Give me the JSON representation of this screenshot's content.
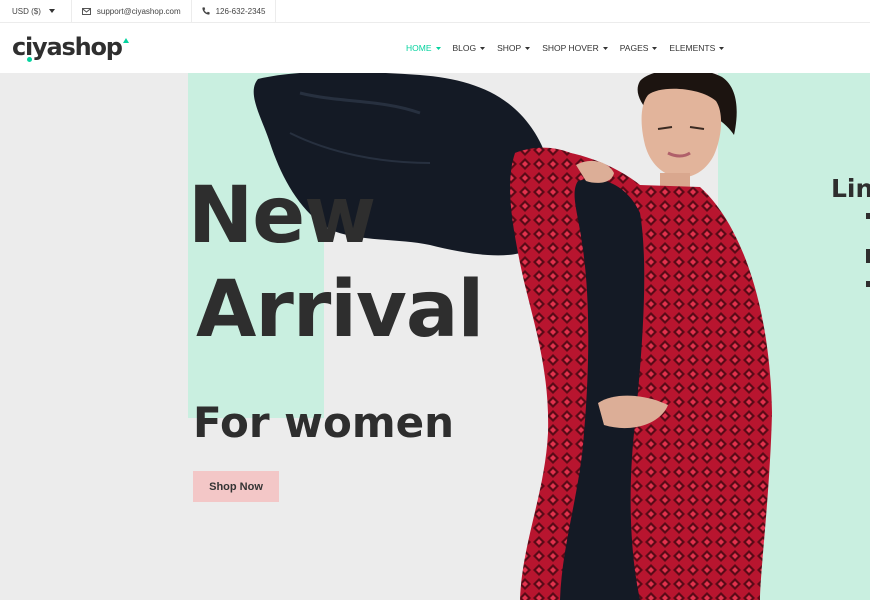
{
  "topbar": {
    "currency": "USD ($)",
    "email": "support@ciyashop.com",
    "phone": "126-632-2345"
  },
  "logo": {
    "text": "ciyashop"
  },
  "nav": {
    "items": [
      {
        "label": "HOME",
        "active": true
      },
      {
        "label": "BLOG",
        "active": false
      },
      {
        "label": "SHOP",
        "active": false
      },
      {
        "label": "SHOP HOVER",
        "active": false
      },
      {
        "label": "PAGES",
        "active": false
      },
      {
        "label": "ELEMENTS",
        "active": false
      }
    ]
  },
  "hero": {
    "line1": "New",
    "line2": "Arrival",
    "line3": "For women",
    "button": "Shop Now",
    "next_slide_fragment": "Lin"
  },
  "colors": {
    "accent": "#04d39f",
    "mint": "#c9efe0",
    "hero_bg": "#ececec",
    "button_bg": "#f3c7c7",
    "dress": "#b8152f"
  },
  "icons": [
    "chevron-down-icon",
    "envelope-icon",
    "phone-icon"
  ]
}
